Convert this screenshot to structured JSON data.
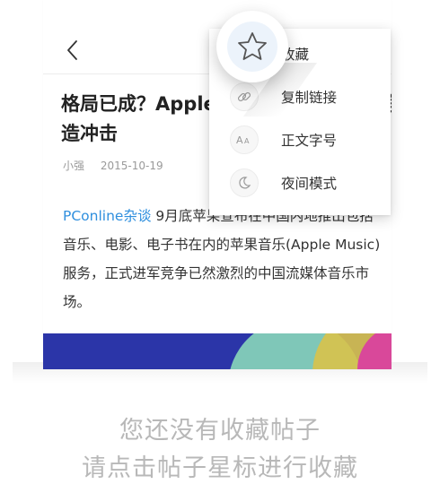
{
  "article": {
    "title": "格局已成？Apple Music 正式进军竞争\n造冲击",
    "author": "小强",
    "date": "2015-10-19",
    "source": "PConline杂谈",
    "body": "9月底苹果宣布在中国内地推出包括音乐、电影、电子书在内的苹果音乐(Apple Music)服务，正式进军竞争已然激烈的中国流媒体音乐市场。"
  },
  "menu": {
    "items": [
      {
        "label": "收藏",
        "icon": "star-icon"
      },
      {
        "label": "复制链接",
        "icon": "link-icon"
      },
      {
        "label": "正文字号",
        "icon": "font-size-icon"
      },
      {
        "label": "夜间模式",
        "icon": "moon-icon"
      }
    ]
  },
  "empty_state": {
    "line1": "您还没有收藏帖子",
    "line2": "请点击帖子星标进行收藏"
  },
  "colors": {
    "accent": "#2f8fde",
    "hint_text": "#b8b8b8",
    "hero_bg": "#2b35a8"
  }
}
